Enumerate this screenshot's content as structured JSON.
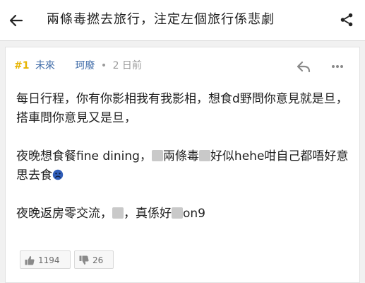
{
  "header": {
    "title": "兩條毒撚去旅行，注定左個旅行係悲劇",
    "back_icon": "arrow-left-icon",
    "share_icon": "share-icon"
  },
  "post": {
    "floor": "#1",
    "author": "未來",
    "username": "珂廢",
    "separator": "•",
    "time": "2 日前",
    "paragraphs": [
      {
        "segments": [
          "每日行程，你有你影相我有我影相，想食d野問你意見就是旦，搭車問你意見又是旦，"
        ]
      },
      {
        "segments": [
          "夜晚想食餐fine dining，",
          "兩條毒",
          "好似hehe咁自己都唔好意思去食"
        ]
      },
      {
        "segments": [
          "夜晚返房零交流，",
          "，真係好",
          "on9"
        ]
      }
    ]
  },
  "votes": {
    "likes": "1194",
    "dislikes": "26"
  },
  "colors": {
    "floor": "#e7b400",
    "author": "#3f6ba8",
    "meta": "#9a9a9a",
    "background": "#f1f1f1"
  }
}
